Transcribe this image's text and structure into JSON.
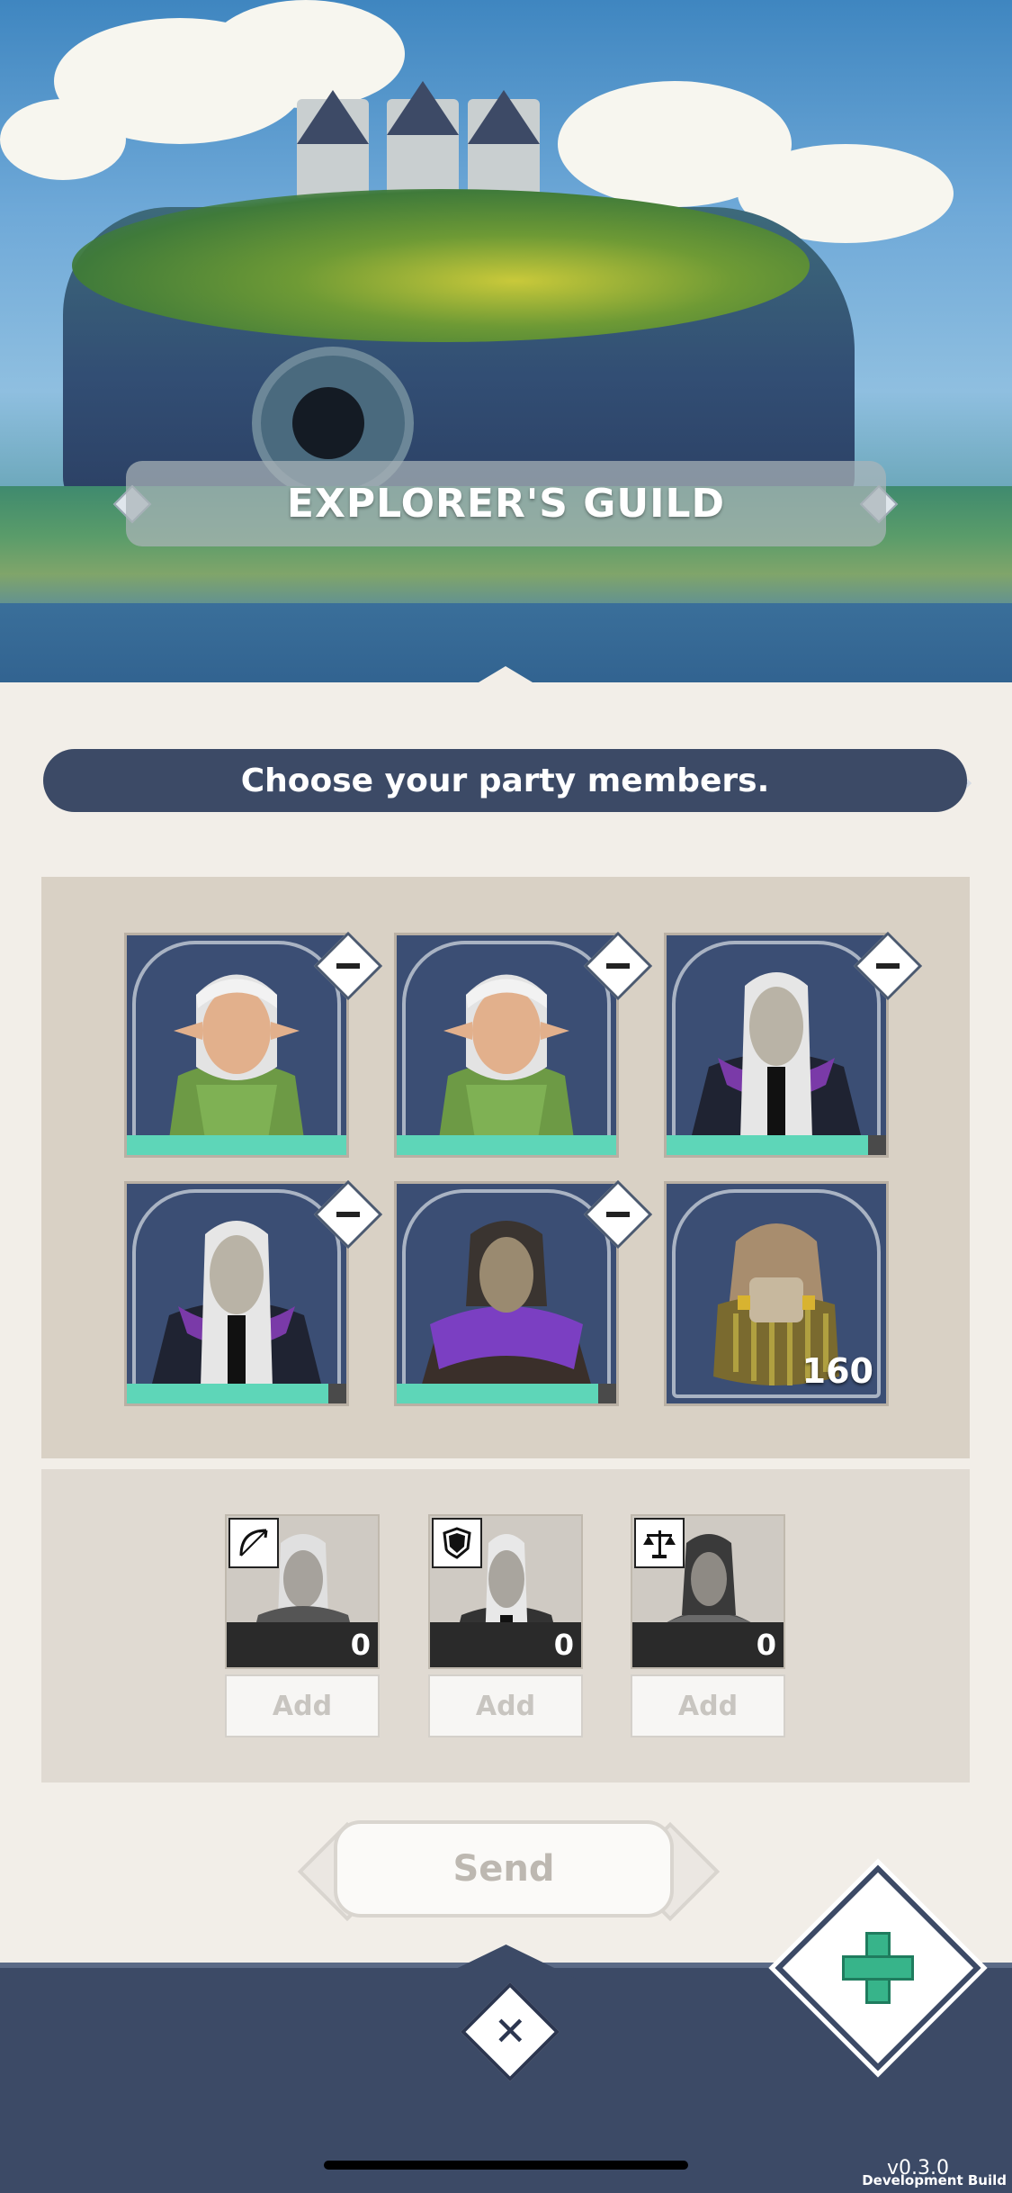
{
  "header": {
    "title": "EXPLORER'S GUILD"
  },
  "prompt": {
    "text": "Choose your party members."
  },
  "party": {
    "members": [
      {
        "name": "elf-ranger",
        "health": 1.0
      },
      {
        "name": "elf-ranger",
        "health": 1.0
      },
      {
        "name": "elf-mage",
        "health": 0.92
      },
      {
        "name": "elf-mage",
        "health": 0.92
      },
      {
        "name": "elf-rogue",
        "health": 0.92
      }
    ],
    "backpack": {
      "count": "160"
    }
  },
  "roles": [
    {
      "icon": "bow-icon",
      "count": "0",
      "add_label": "Add"
    },
    {
      "icon": "shield-icon",
      "count": "0",
      "add_label": "Add"
    },
    {
      "icon": "scales-icon",
      "count": "0",
      "add_label": "Add"
    }
  ],
  "actions": {
    "send_label": "Send"
  },
  "footer": {
    "version": "v0.3.0",
    "build": "Development Build"
  },
  "colors": {
    "navy": "#3c4a66",
    "teal": "#5ed6b8",
    "heal_green": "#37b48a"
  }
}
